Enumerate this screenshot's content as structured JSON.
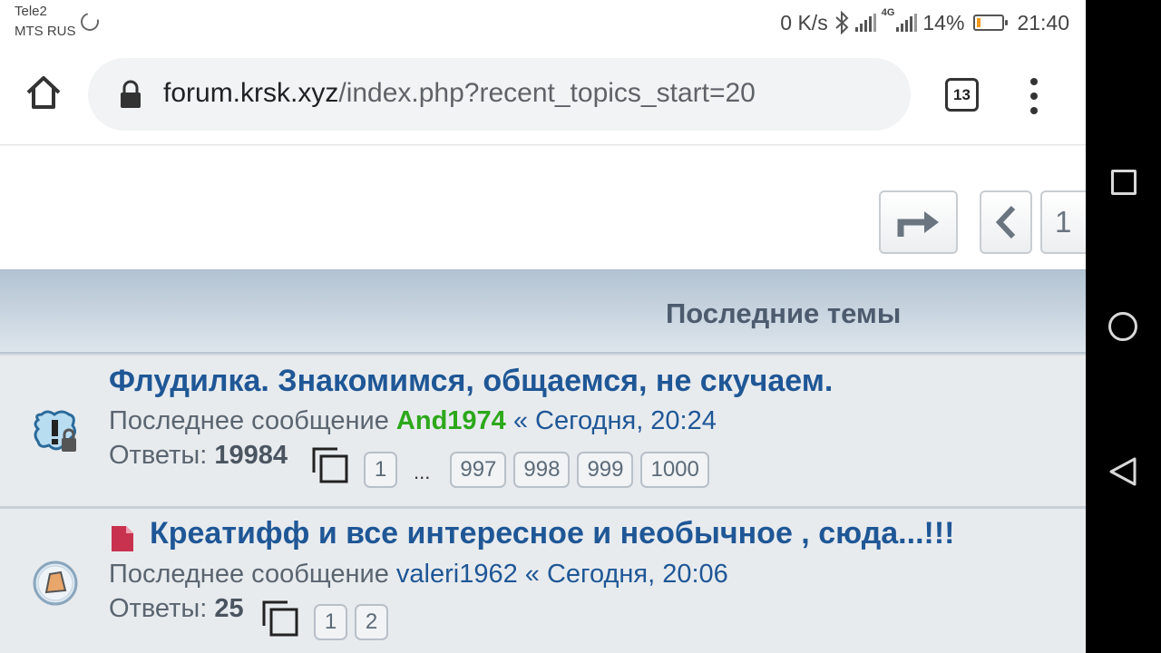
{
  "status_bar": {
    "carrier_1": "Tele2",
    "carrier_2": "MTS RUS",
    "net_speed": "0 K/s",
    "network_type": "4G",
    "battery_percent": "14%",
    "battery_level": 0.14,
    "battery_color": "#f39a1b",
    "time": "21:40"
  },
  "browser": {
    "url_domain": "forum.krsk.xyz",
    "url_path": "/index.php?recent_topics_start=20",
    "tab_count": "13"
  },
  "page": {
    "page_number_button": "1",
    "section_title": "Последние темы",
    "topics": [
      {
        "title": "Флудилка. Знакомимся, общаемся, не скучаем.",
        "last_post_label": "Последнее сообщение",
        "author": "And1974",
        "date": "« Сегодня, 20:24",
        "replies_label": "Ответы:",
        "replies_count": "19984",
        "pages": [
          "1",
          "997",
          "998",
          "999",
          "1000"
        ],
        "pages_ellipsis": "..."
      },
      {
        "title": "Креатифф и все интересное и необычное , сюда...!!!",
        "last_post_label": "Последнее сообщение",
        "author": "valeri1962",
        "date": "« Сегодня, 20:06",
        "replies_label": "Ответы:",
        "replies_count": "25",
        "pages": [
          "1",
          "2"
        ]
      }
    ]
  },
  "colors": {
    "topic_link": "#1f5796",
    "author_highlight": "#2ca81a",
    "header_gradient_top": "#b2c3d2",
    "new_post_icon": "#c8324e"
  },
  "icons": {
    "home": "home-icon",
    "lock": "lock-icon",
    "menu": "more-vert-icon",
    "reply": "reply-arrow-icon",
    "prev": "chevron-left-icon",
    "topic_1": "hot-locked-topic-icon",
    "topic_2": "topic-icon",
    "new": "new-post-doc-icon",
    "pages": "copy-pages-icon"
  }
}
